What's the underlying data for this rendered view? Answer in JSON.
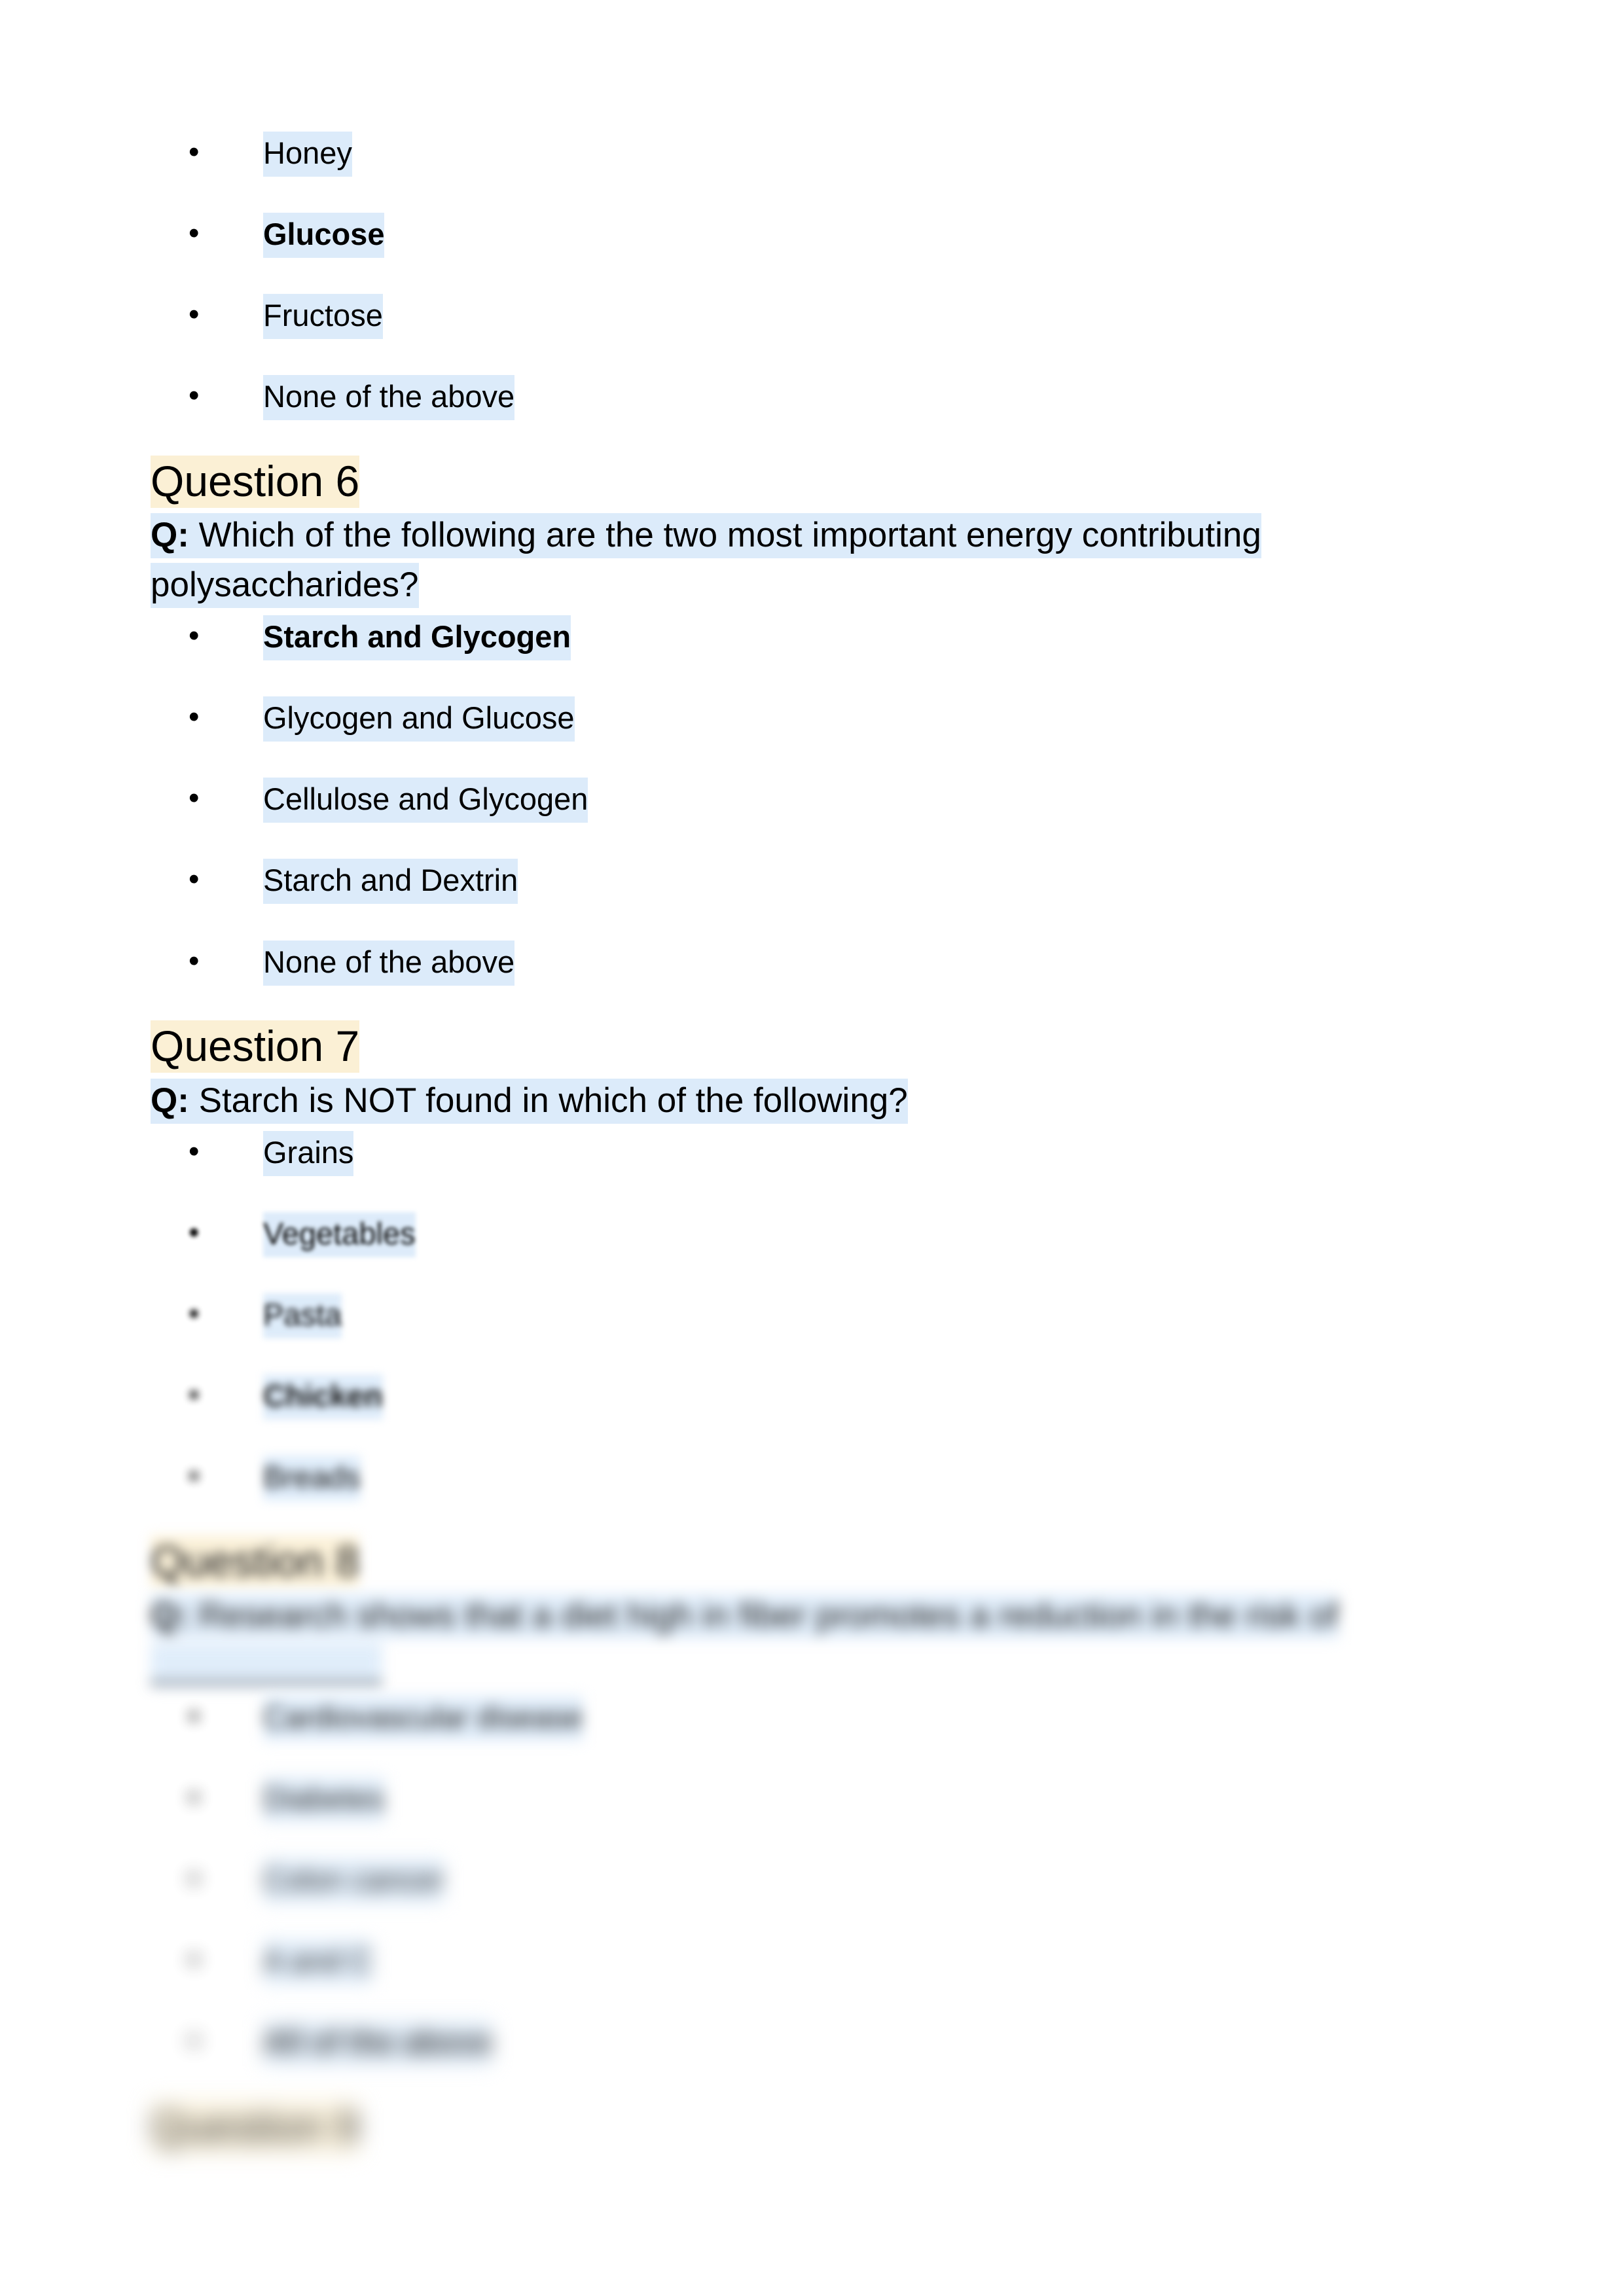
{
  "document": {
    "highlight_blue": "#DCEBFA",
    "highlight_cream": "#FBF0D5",
    "question_prefix": "Q:"
  },
  "continued_options": [
    {
      "text": "Honey",
      "bold": false
    },
    {
      "text": "Glucose",
      "bold": true
    },
    {
      "text": "Fructose",
      "bold": false
    },
    {
      "text": "None of the above",
      "bold": false
    }
  ],
  "questions": [
    {
      "heading": "Question 6",
      "prefix": "Q:",
      "prompt": "Which of the following are the two most important energy contributing polysaccharides?",
      "options": [
        {
          "text": "Starch and Glycogen",
          "bold": true
        },
        {
          "text": "Glycogen and Glucose",
          "bold": false
        },
        {
          "text": "Cellulose and Glycogen",
          "bold": false
        },
        {
          "text": "Starch and Dextrin",
          "bold": false
        },
        {
          "text": "None of the above",
          "bold": false
        }
      ]
    },
    {
      "heading": "Question 7",
      "prefix": "Q:",
      "prompt": "Starch is NOT found in which of the following?",
      "options": [
        {
          "text": "Grains",
          "bold": false
        },
        {
          "text": "Vegetables",
          "bold": false
        },
        {
          "text": "Pasta",
          "bold": false
        },
        {
          "text": "Chicken",
          "bold": true
        },
        {
          "text": "Breads",
          "bold": false
        }
      ]
    },
    {
      "heading": "Question 8",
      "prefix": "Q:",
      "prompt": "Research shows that a diet high in fiber promotes a reduction in the risk of ____________",
      "options": [
        {
          "text": "Cardiovascular disease",
          "bold": false
        },
        {
          "text": "Diabetes",
          "bold": false
        },
        {
          "text": "Colon cancer",
          "bold": false
        },
        {
          "text": "A and C",
          "bold": false
        },
        {
          "text": "All of the above",
          "bold": true
        }
      ]
    },
    {
      "heading": "Question 9",
      "prefix": "",
      "prompt": "",
      "options": []
    }
  ]
}
